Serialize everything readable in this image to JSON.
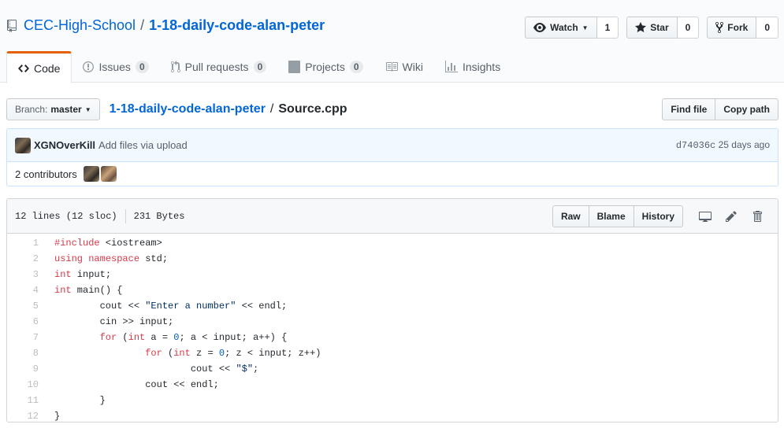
{
  "repo": {
    "owner": "CEC-High-School",
    "separator": "/",
    "name": "1-18-daily-code-alan-peter"
  },
  "actions": {
    "watch_label": "Watch",
    "watch_count": "1",
    "star_label": "Star",
    "star_count": "0",
    "fork_label": "Fork",
    "fork_count": "0"
  },
  "tabs": [
    {
      "label": "Code",
      "count": ""
    },
    {
      "label": "Issues",
      "count": "0"
    },
    {
      "label": "Pull requests",
      "count": "0"
    },
    {
      "label": "Projects",
      "count": "0"
    },
    {
      "label": "Wiki",
      "count": ""
    },
    {
      "label": "Insights",
      "count": ""
    }
  ],
  "file_nav": {
    "branch_label": "Branch:",
    "branch_value": "master",
    "path_repo": "1-18-daily-code-alan-peter",
    "path_sep": "/",
    "path_file": "Source.cpp",
    "find_file": "Find file",
    "copy_path": "Copy path"
  },
  "commit": {
    "author": "XGNOverKill",
    "message": "Add files via upload",
    "sha": "d74036c",
    "time": "25 days ago",
    "contributors_label": "2 contributors"
  },
  "file": {
    "lines_info": "12 lines (12 sloc)",
    "size": "231 Bytes",
    "raw": "Raw",
    "blame": "Blame",
    "history": "History"
  },
  "code_lines": [
    {
      "num": "1",
      "text": "#include <iostream>"
    },
    {
      "num": "2",
      "text": "using namespace std;"
    },
    {
      "num": "3",
      "text": "int input;"
    },
    {
      "num": "4",
      "text": "int main() {"
    },
    {
      "num": "5",
      "text": "        cout << \"Enter a number\" << endl;"
    },
    {
      "num": "6",
      "text": "        cin >> input;"
    },
    {
      "num": "7",
      "text": "        for (int a = 0; a < input; a++) {"
    },
    {
      "num": "8",
      "text": "                for (int z = 0; z < input; z++)"
    },
    {
      "num": "9",
      "text": "                        cout << \"$\";"
    },
    {
      "num": "10",
      "text": "                cout << endl;"
    },
    {
      "num": "11",
      "text": "        }"
    },
    {
      "num": "12",
      "text": "}"
    }
  ],
  "colors": {
    "link": "#0366d6",
    "tab_accent": "#e36209",
    "keyword": "#d73a49",
    "string": "#032f62",
    "number": "#005cc5"
  }
}
